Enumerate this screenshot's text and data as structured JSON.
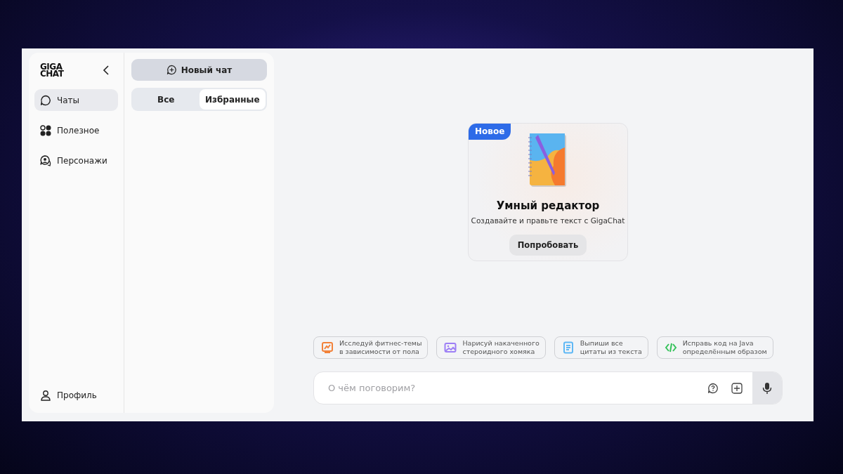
{
  "logo": {
    "lines": [
      "GIGA",
      "CHAT"
    ]
  },
  "nav": [
    {
      "label": "Чаты",
      "kind": "chat",
      "selected": true
    },
    {
      "label": "Полезное",
      "kind": "dots",
      "selected": false
    },
    {
      "label": "Персонажи",
      "kind": "persona",
      "selected": false
    }
  ],
  "profile": {
    "label": "Профиль"
  },
  "new_chat": {
    "label": "Новый чат"
  },
  "filter_tabs": [
    {
      "label": "Все",
      "selected": false
    },
    {
      "label": "Избранные",
      "selected": true
    }
  ],
  "promo": {
    "badge": "Новое",
    "title": "Умный редактор",
    "subtitle": "Создавайте и правьте текст с GigaChat",
    "button": "Попробовать"
  },
  "suggestions": [
    {
      "kind": "chart",
      "color": "#f2823a",
      "lines": [
        "Исследуй фитнес-темы",
        "в зависимости от пола"
      ]
    },
    {
      "kind": "image",
      "color": "#9d7ff5",
      "lines": [
        "Нарисуй накаченного",
        "стероидного хомяка"
      ]
    },
    {
      "kind": "document",
      "color": "#5fb8f5",
      "lines": [
        "Выпиши все",
        "цитаты из текста"
      ]
    },
    {
      "kind": "code",
      "color": "#35c25a",
      "lines": [
        "Исправь код на Java",
        "определённым образом"
      ]
    }
  ],
  "composer": {
    "placeholder": "О чём поговорим?"
  }
}
